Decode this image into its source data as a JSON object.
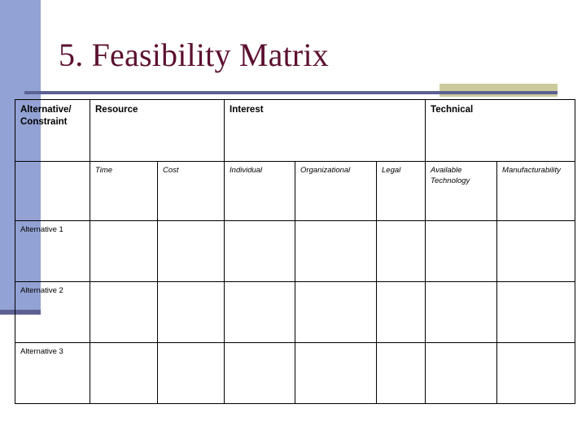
{
  "slide": {
    "title": "5. Feasibility Matrix",
    "title_color": "#5c1030",
    "accent_blue": "#93a2d4",
    "accent_blue_dark": "#5c6193",
    "accent_khaki": "#ccca9c",
    "background": "#ffffff"
  },
  "matrix": {
    "group_headers": [
      {
        "label": "Alternative/\nConstraint",
        "span": 1
      },
      {
        "label": "Resource",
        "span": 2
      },
      {
        "label": "Interest",
        "span": 3
      },
      {
        "label": "Technical",
        "span": 2
      }
    ],
    "group_header_lines": {
      "col0_line1": "Alternative/",
      "col0_line2": "Constraint",
      "col1": "Resource",
      "col2": "Interest",
      "col3": "Technical"
    },
    "sub_headers": [
      "",
      "Time",
      "Cost",
      "Individual",
      "Organizational",
      "Legal",
      "Available Technology",
      "Manufacturability"
    ],
    "sub_header_lines": {
      "available_technology_line1": "Available",
      "available_technology_line2": "Technology"
    },
    "rows": [
      {
        "label": "Alternative 1",
        "cells": [
          "",
          "",
          "",
          "",
          "",
          "",
          ""
        ]
      },
      {
        "label": "Alternative 2",
        "cells": [
          "",
          "",
          "",
          "",
          "",
          "",
          ""
        ]
      },
      {
        "label": "Alternative 3",
        "cells": [
          "",
          "",
          "",
          "",
          "",
          "",
          ""
        ]
      }
    ]
  }
}
